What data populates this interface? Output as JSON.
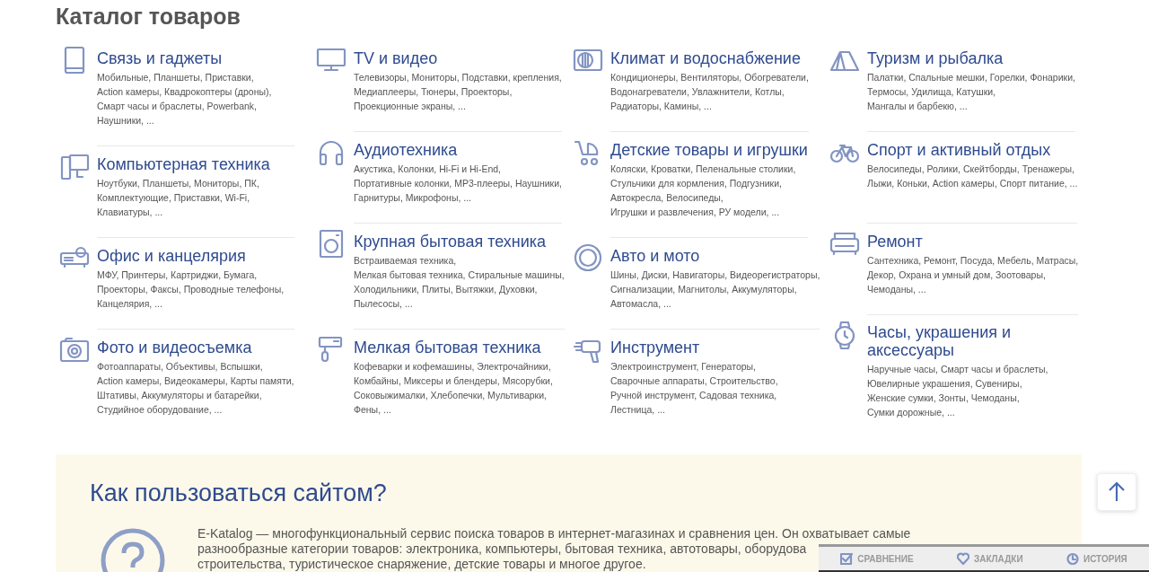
{
  "title": "Каталог товаров",
  "columns": [
    {
      "categories": [
        {
          "title": "Связь и гаджеты",
          "lines": [
            "Мобильные, Планшеты, Приставки,",
            "Action камеры, Квадрокоптеры (дроны),",
            "Смарт часы и браслеты, Powerbank,",
            "Наушники, ..."
          ]
        },
        {
          "title": "Компьютерная техника",
          "lines": [
            "Ноутбуки, Планшеты, Мониторы, ПК,",
            "Комплектующие, Приставки, Wi-Fi,",
            "Клавиатуры, ..."
          ]
        },
        {
          "title": "Офис и канцелярия",
          "lines": [
            "МФУ, Принтеры, Картриджи, Бумага,",
            "Проекторы, Факсы, Проводные телефоны,",
            "Канцелярия, ..."
          ]
        },
        {
          "title": "Фото и видеосъемка",
          "lines": [
            "Фотоаппараты, Объективы, Вспышки,",
            "Action камеры, Видеокамеры, Карты памяти,",
            "Штативы, Аккумуляторы и батарейки,",
            "Студийное оборудование, ..."
          ]
        }
      ]
    },
    {
      "categories": [
        {
          "title": "TV и видео",
          "lines": [
            "Телевизоры, Мониторы, Подставки, крепления,",
            "Медиаплееры, Тюнеры, Проекторы,",
            "Проекционные экраны, ..."
          ]
        },
        {
          "title": "Аудиотехника",
          "lines": [
            "Акустика, Колонки, Hi-Fi и Hi-End,",
            "Портативные колонки, MP3-плееры, Наушники,",
            "Гарнитуры, Микрофоны, ..."
          ]
        },
        {
          "title": "Крупная бытовая техника",
          "lines": [
            "Встраиваемая техника,",
            "Мелкая бытовая техника, Стиральные машины,",
            "Холодильники, Плиты, Вытяжки, Духовки,",
            "Пылесосы, ..."
          ]
        },
        {
          "title": "Мелкая бытовая техника",
          "lines": [
            "Кофеварки и кофемашины, Электрочайники,",
            "Комбайны, Миксеры и блендеры, Мясорубки,",
            "Соковыжималки, Хлебопечки, Мультиварки,",
            "Фены, ..."
          ]
        }
      ]
    },
    {
      "categories": [
        {
          "title": "Климат и водоснабжение",
          "lines": [
            "Кондиционеры, Вентиляторы, Обогреватели,",
            "Водонагреватели, Увлажнители, Котлы,",
            "Радиаторы, Камины, ..."
          ]
        },
        {
          "title": "Детские товары и игрушки",
          "lines": [
            "Коляски, Кроватки, Пеленальные столики,",
            "Стульчики для кормления, Подгузники,",
            "Автокресла, Велосипеды,",
            "Игрушки и развлечения, РУ модели, ..."
          ]
        },
        {
          "title": "Авто и мото",
          "lines": [
            "Шины, Диски, Навигаторы, Видеорегистраторы,",
            "Сигнализации, Магнитолы, Аккумуляторы,",
            "Автомасла, ..."
          ]
        },
        {
          "title": "Инструмент",
          "lines": [
            "Электроинструмент, Генераторы,",
            "Сварочные аппараты, Строительство,",
            "Ручной инструмент, Садовая техника,",
            "Лестница, ..."
          ]
        }
      ]
    },
    {
      "categories": [
        {
          "title": "Туризм и рыбалка",
          "lines": [
            "Палатки, Спальные мешки, Горелки, Фонарики,",
            "Термосы, Удилища, Катушки,",
            "Мангалы и барбекю, ..."
          ]
        },
        {
          "title": "Спорт и активный отдых",
          "lines": [
            "Велосипеды, Ролики, Скейтборды, Тренажеры,",
            "Лыжи, Коньки, Action камеры, Спорт питание, ..."
          ]
        },
        {
          "title": "Ремонт",
          "lines": [
            "Сантехника, Ремонт, Посуда, Мебель, Матрасы,",
            "Декор, Охрана и умный дом, Зоотовары,",
            "Чемоданы, ..."
          ]
        },
        {
          "title": "Часы, украшения и аксессуары",
          "lines": [
            "Наручные часы, Смарт часы и браслеты,",
            "Ювелирные украшения, Сувениры,",
            "Женские сумки, Зонты, Чемоданы,",
            "Сумки дорожные, ..."
          ]
        }
      ]
    }
  ],
  "help": {
    "heading": "Как пользоваться сайтом?",
    "lines": [
      "E-Katalog — многофункциональный сервис поиска товаров в интернет-магазинах и сравнения цен. Он охватывает самые",
      "разнообразные категории товаров: электроника, компьютеры, бытовая техника, автотовары, оборудова",
      "строительства, туристическое снаряжение, детские товары и многое другое."
    ]
  },
  "bottom_bar": [
    {
      "label": "СРАВНЕНИЕ"
    },
    {
      "label": "ЗАКЛАДКИ"
    },
    {
      "label": "ИСТОРИЯ"
    }
  ]
}
